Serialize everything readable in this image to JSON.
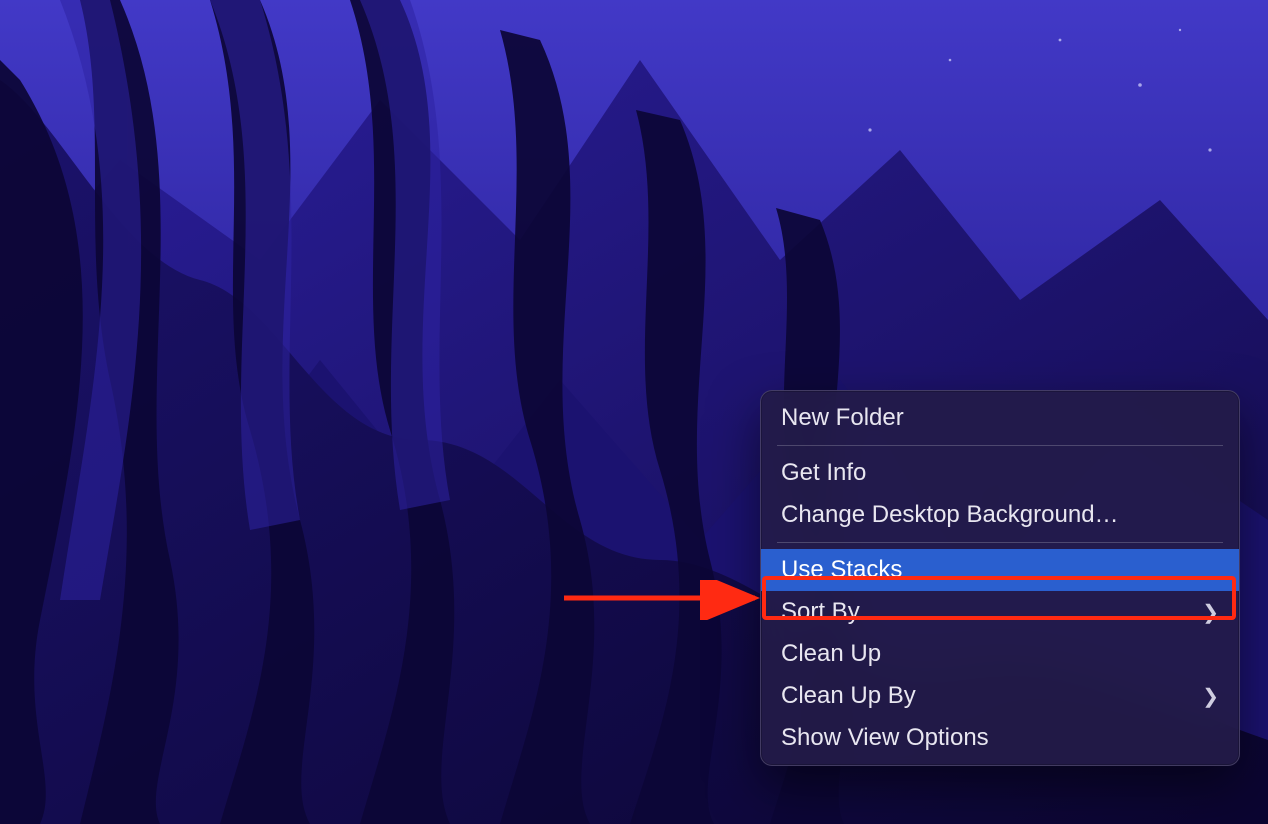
{
  "context_menu": {
    "items": [
      {
        "label": "New Folder",
        "submenu": false,
        "highlight": false
      },
      "sep",
      {
        "label": "Get Info",
        "submenu": false,
        "highlight": false
      },
      {
        "label": "Change Desktop Background…",
        "submenu": false,
        "highlight": false
      },
      "sep",
      {
        "label": "Use Stacks",
        "submenu": false,
        "highlight": true
      },
      {
        "label": "Sort By",
        "submenu": true,
        "highlight": false
      },
      {
        "label": "Clean Up",
        "submenu": false,
        "highlight": false
      },
      {
        "label": "Clean Up By",
        "submenu": true,
        "highlight": false
      },
      {
        "label": "Show View Options",
        "submenu": false,
        "highlight": false
      }
    ]
  },
  "annotation": {
    "target_label": "Use Stacks",
    "color": "#ff2a12"
  },
  "wallpaper": {
    "palette": {
      "sky_top": "#3b34b0",
      "sky_mid": "#3029a3",
      "mountain_light": "#2f24a6",
      "mountain_dark": "#100a3e",
      "stripe": "#1a1060"
    }
  }
}
